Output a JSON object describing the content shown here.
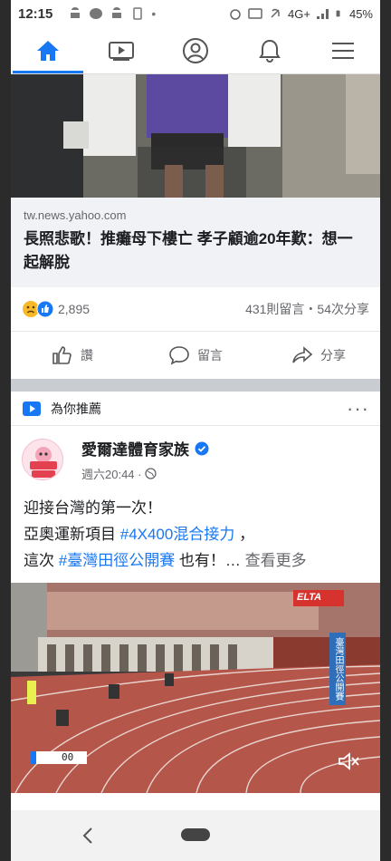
{
  "status_bar": {
    "time": "12:15",
    "network": "4G+",
    "battery": "45%"
  },
  "nav": {
    "tabs": [
      {
        "icon": "home-icon",
        "active": true
      },
      {
        "icon": "video-icon",
        "active": false
      },
      {
        "icon": "profile-icon",
        "active": false
      },
      {
        "icon": "bell-icon",
        "active": false
      },
      {
        "icon": "menu-icon",
        "active": false
      }
    ]
  },
  "post1": {
    "link_domain": "tw.news.yahoo.com",
    "link_title": "長照悲歌！推癱母下樓亡 孝子顧逾20年歎：想一起解脫",
    "reaction_count": "2,895",
    "stats": "431則留言・54次分享",
    "actions": {
      "like": "讚",
      "comment": "留言",
      "share": "分享"
    }
  },
  "recommended": {
    "header": "為你推薦",
    "more": "···",
    "page_name": "愛爾達體育家族",
    "post_time": "週六20:44 ·",
    "text": {
      "line1": "迎接台灣的第一次！",
      "line2_prefix": "亞奧運新項目 ",
      "line2_tag": "#4X400混合接力",
      "line2_suffix": " ，",
      "line3_prefix": "這次 ",
      "line3_tag": "#臺灣田徑公開賽",
      "line3_suffix": " 也有！… ",
      "see_more": "查看更多"
    },
    "video": {
      "timer": "00",
      "channel_badge": "ELTA",
      "banner": "臺灣田徑公開賽"
    }
  },
  "colors": {
    "accent": "#1877f2",
    "track": "#b5564a"
  }
}
